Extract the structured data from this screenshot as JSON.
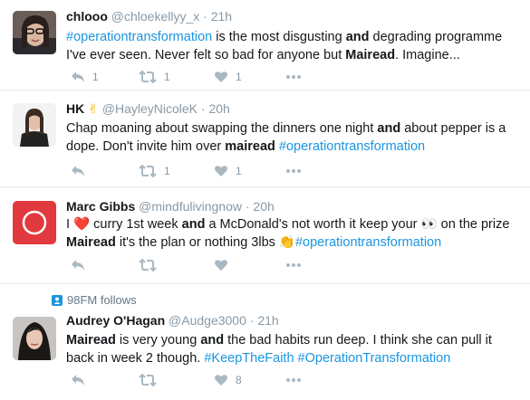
{
  "tweets": [
    {
      "name": "chlooo",
      "handle": "@chloekellyy_x",
      "time": "21h",
      "reply_count": "1",
      "retweet_count": "1",
      "like_count": "1",
      "body": {
        "t1": "#operationtransformation",
        "t2": " is the most disgusting ",
        "t3": "and",
        "t4": " degrading programme I've ever seen. Never felt so bad for anyone but ",
        "t5": "Mairead",
        "t6": ". Imagine..."
      }
    },
    {
      "name": "HK",
      "name_emoji": "✌",
      "handle": "@HayleyNicoleK",
      "time": "20h",
      "retweet_count": "1",
      "like_count": "1",
      "body": {
        "t1": "Chap moaning about swapping the dinners one night ",
        "t2": "and",
        "t3": " about pepper is a dope. Don't invite him over ",
        "t4": "mairead",
        "t5": " ",
        "t6": "#operationtransformation"
      }
    },
    {
      "name": "Marc Gibbs",
      "handle": "@mindfulivingnow",
      "time": "20h",
      "body": {
        "t1": "I ",
        "heart": "❤️",
        "t2": " curry 1st week ",
        "t3": "and",
        "t4": " a McDonald's not worth it keep your ",
        "eyes": "👀",
        "t5": " on the prize ",
        "t6": "Mairead",
        "t7": " it's the plan or nothing 3lbs ",
        "clap": "👏",
        "t8": "#operationtransformation"
      }
    },
    {
      "context": "98FM follows",
      "name": "Audrey O'Hagan",
      "handle": "@Audge3000",
      "time": "21h",
      "like_count": "8",
      "body": {
        "t1": "Mairead",
        "t2": " is very young ",
        "t3": "and",
        "t4": " the bad habits run deep. I think she can pull it back in week 2 though. ",
        "t5": "#KeepTheFaith",
        "t6": " ",
        "t7": "#OperationTransformation"
      }
    }
  ],
  "icons": {
    "reply": "reply-icon",
    "retweet": "retweet-icon",
    "like": "heart-icon",
    "more": "more-icon",
    "follow": "person-icon"
  },
  "colors": {
    "hashtag": "#1b95e0",
    "muted": "#8899a6",
    "icon": "#aab8c2",
    "border": "#e1e8ed",
    "marc_avatar": "#e0393e"
  }
}
